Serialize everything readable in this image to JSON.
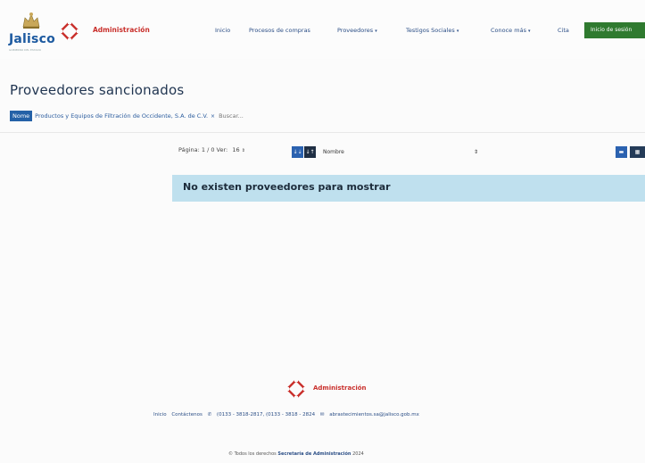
{
  "header": {
    "logo_text": "Jalisco",
    "logo_subtext": "GOBIERNO DEL ESTADO",
    "admin_text": "Administración",
    "nav": [
      {
        "label": "Inicio",
        "has_caret": false
      },
      {
        "label": "Procesos de compras",
        "has_caret": false
      },
      {
        "label": "Proveedores",
        "has_caret": true
      },
      {
        "label": "Testigos Sociales",
        "has_caret": true
      },
      {
        "label": "Conoce más",
        "has_caret": true
      },
      {
        "label": "Cita",
        "has_caret": false
      }
    ],
    "login_label": "Inicio de sesión"
  },
  "main": {
    "title": "Proveedores sancionados",
    "filter": {
      "label": "Nome",
      "value": "Productos y Equipos de Filtración de Occidente, S.A. de C.V.",
      "close": "×",
      "search_link": "Buscar..."
    },
    "toolbar": {
      "page_text": "Página: 1 / 0 Ver:",
      "per_page": "16",
      "select_caret": "⇕",
      "sort_asc": "↓⇣",
      "sort_desc": "↓↑",
      "sort_field": "Nombre",
      "view_list": "▬",
      "view_grid": "▦"
    },
    "empty_message": "No existen proveedores para mostrar"
  },
  "footer": {
    "admin_text": "Administración",
    "links": [
      "Inicio",
      "Contáctenos",
      "(0133 - 3818-2817, (0133 - 3818 - 2824",
      "abrastecimientos.sa@jalisco.gob.mx"
    ],
    "copyright_prefix": "© Todos los derechos",
    "copyright_org": "Secretaría de Administración",
    "copyright_year": "2024"
  },
  "colors": {
    "brand_red": "#c9302c",
    "brand_blue": "#1d5aa0",
    "login_green": "#2f7a2f",
    "banner_blue": "#bfe0ee"
  }
}
